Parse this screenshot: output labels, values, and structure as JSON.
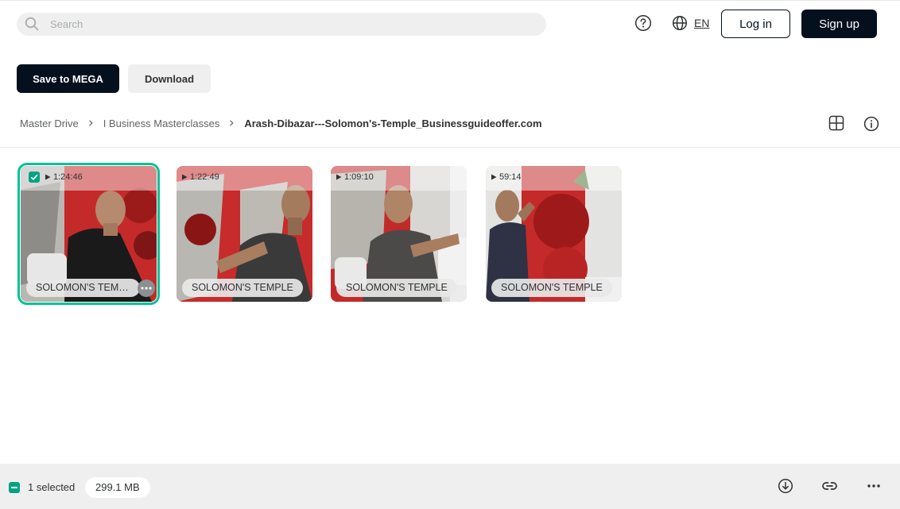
{
  "header": {
    "search_placeholder": "Search",
    "language": "EN",
    "login_label": "Log in",
    "signup_label": "Sign up"
  },
  "actions": {
    "save_label": "Save to MEGA",
    "download_label": "Download"
  },
  "breadcrumb": {
    "items": [
      "Master Drive",
      "I Business Masterclasses"
    ],
    "current": "Arash-Dibazar---Solomon's-Temple_Businessguideoffer.com"
  },
  "files": [
    {
      "name": "SOLOMON'S TEMPLE",
      "duration": "1:24:46",
      "selected": true
    },
    {
      "name": "SOLOMON'S TEMPLE",
      "duration": "1:22:49",
      "selected": false
    },
    {
      "name": "SOLOMON'S TEMPLE",
      "duration": "1:09:10",
      "selected": false
    },
    {
      "name": "SOLOMON'S TEMPLE",
      "duration": "59:14",
      "selected": false
    }
  ],
  "footer": {
    "selected_text": "1 selected",
    "size": "299.1 MB"
  },
  "colors": {
    "primary": "#04101e",
    "accent": "#00c398",
    "check": "#00a382",
    "surface": "#efefef"
  },
  "icons": {
    "search": "search-icon",
    "help": "help-icon",
    "language": "globe-icon",
    "view": "grid-view-icon",
    "info": "info-icon",
    "footer": [
      "download-icon",
      "link-icon",
      "more-icon"
    ]
  }
}
